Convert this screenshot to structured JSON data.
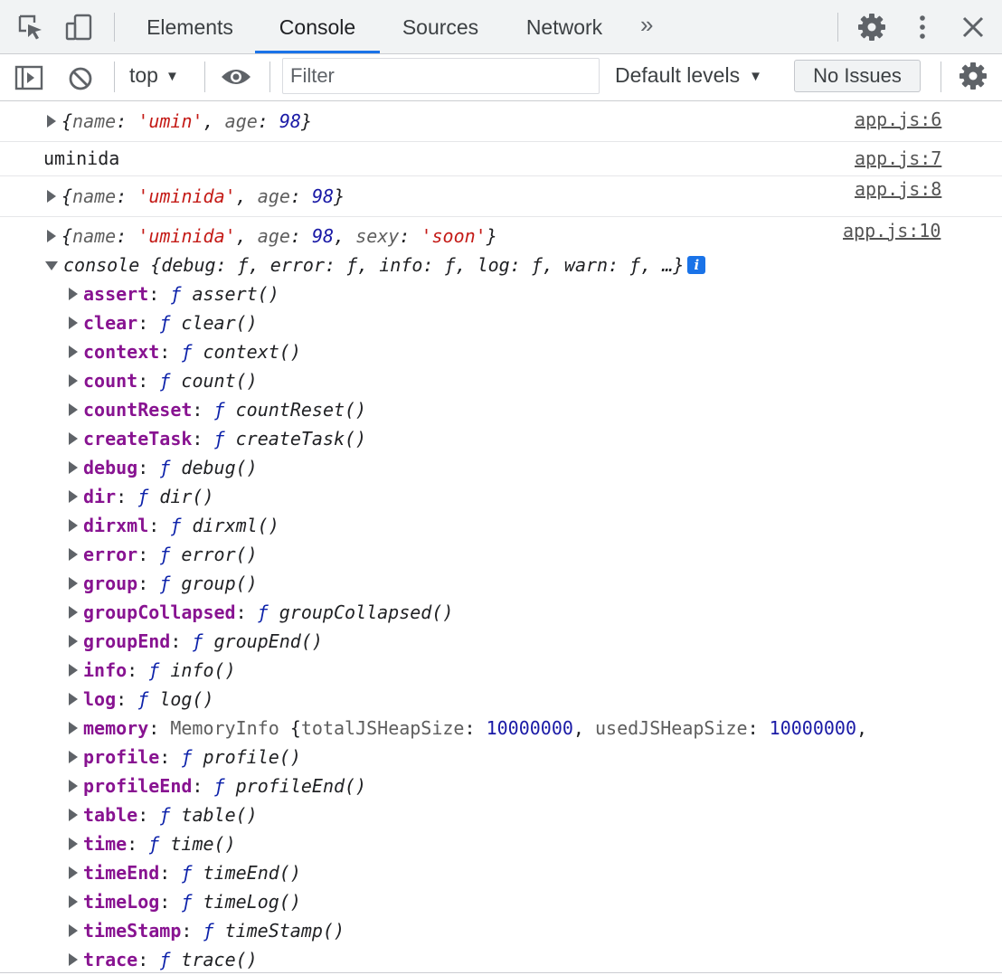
{
  "tabs": {
    "items": [
      "Elements",
      "Console",
      "Sources",
      "Network"
    ],
    "overflow_glyph": "»"
  },
  "toolbar": {
    "context": "top",
    "caret": "▼",
    "filter_placeholder": "Filter",
    "levels": "Default levels",
    "issues": "No Issues"
  },
  "messages": {
    "m1": {
      "source": "app.js:6",
      "name_key": "name",
      "name_val": "'umin'",
      "age_key": "age",
      "age_val": "98"
    },
    "m2": {
      "text": "uminida",
      "source": "app.js:7"
    },
    "m3": {
      "source": "app.js:8",
      "name_key": "name",
      "name_val": "'uminida'",
      "age_key": "age",
      "age_val": "98"
    },
    "m4": {
      "source": "app.js:10",
      "name_key": "name",
      "name_val": "'uminida'",
      "age_key": "age",
      "age_val": "98",
      "sexy_key": "sexy",
      "sexy_val": "'soon'"
    }
  },
  "console_object": {
    "label": "console",
    "preview": "{debug: ƒ, error: ƒ, info: ƒ, log: ƒ, warn: ƒ, …}",
    "info_badge": "i",
    "properties": [
      {
        "key": "assert",
        "value": "assert()"
      },
      {
        "key": "clear",
        "value": "clear()"
      },
      {
        "key": "context",
        "value": "context()"
      },
      {
        "key": "count",
        "value": "count()"
      },
      {
        "key": "countReset",
        "value": "countReset()"
      },
      {
        "key": "createTask",
        "value": "createTask()"
      },
      {
        "key": "debug",
        "value": "debug()"
      },
      {
        "key": "dir",
        "value": "dir()"
      },
      {
        "key": "dirxml",
        "value": "dirxml()"
      },
      {
        "key": "error",
        "value": "error()"
      },
      {
        "key": "group",
        "value": "group()"
      },
      {
        "key": "groupCollapsed",
        "value": "groupCollapsed()"
      },
      {
        "key": "groupEnd",
        "value": "groupEnd()"
      },
      {
        "key": "info",
        "value": "info()"
      },
      {
        "key": "log",
        "value": "log()"
      },
      {
        "key": "memory",
        "memory": true,
        "class": "MemoryInfo",
        "k1": "totalJSHeapSize",
        "v1": "10000000",
        "k2": "usedJSHeapSize",
        "v2": "10000000"
      },
      {
        "key": "profile",
        "value": "profile()"
      },
      {
        "key": "profileEnd",
        "value": "profileEnd()"
      },
      {
        "key": "table",
        "value": "table()"
      },
      {
        "key": "time",
        "value": "time()"
      },
      {
        "key": "timeEnd",
        "value": "timeEnd()"
      },
      {
        "key": "timeLog",
        "value": "timeLog()"
      },
      {
        "key": "timeStamp",
        "value": "timeStamp()"
      },
      {
        "key": "trace",
        "value": "trace()"
      }
    ]
  },
  "function_glyph": "ƒ",
  "colors": {
    "string": "#c41a16",
    "number": "#1a1aa6",
    "property_key": "#881391",
    "function_value": "#0d22aa",
    "accent": "#1a73e8"
  }
}
